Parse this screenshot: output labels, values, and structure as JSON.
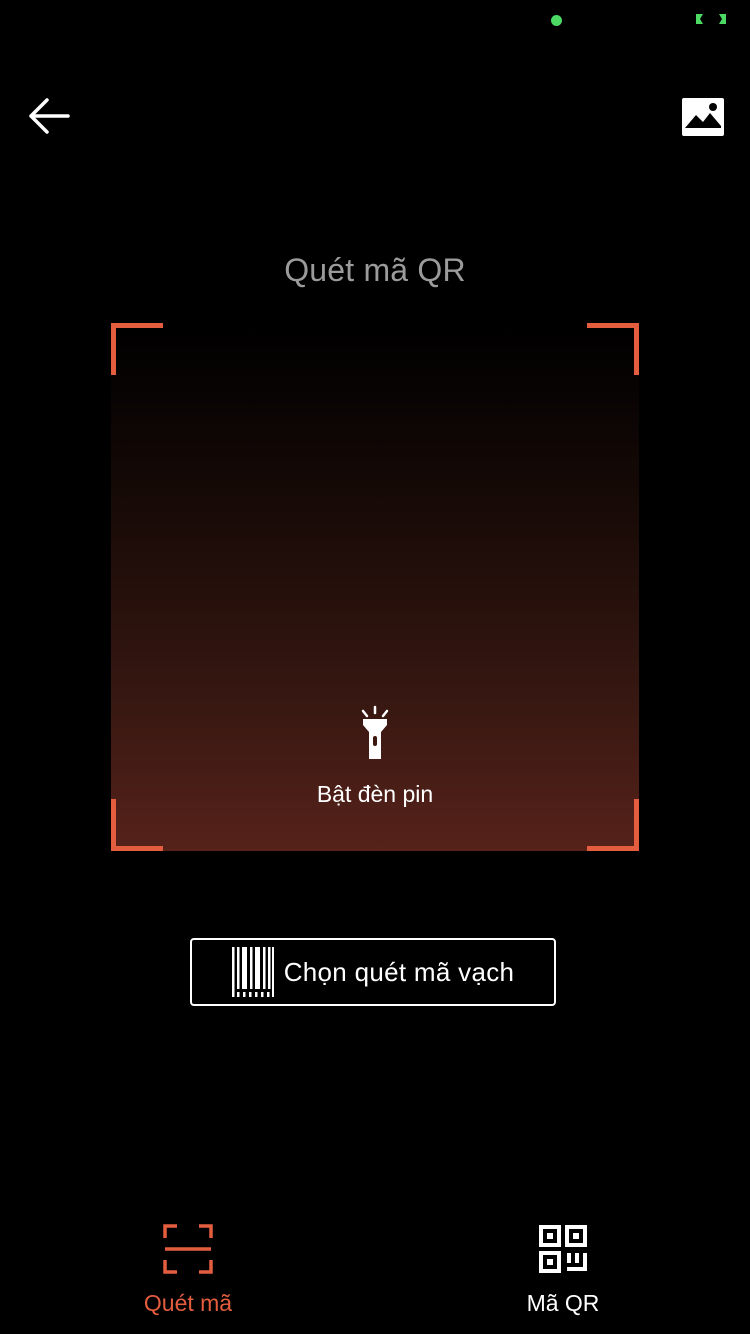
{
  "colors": {
    "background": "#000000",
    "accent": "#e45d3f",
    "status_green": "#4cd964",
    "title_gray": "#9b9b9b",
    "white": "#ffffff"
  },
  "icons": {
    "back": "arrow-left-icon",
    "gallery": "image-gallery-icon",
    "flashlight": "flashlight-icon",
    "barcode": "barcode-icon",
    "scan_tab": "scan-frame-icon",
    "qr_tab": "qr-code-icon"
  },
  "header": {
    "title": "Quét mã QR"
  },
  "scanner": {
    "flash_label": "Bật đèn pin"
  },
  "barcode_button": {
    "label": "Chọn quét mã vạch"
  },
  "bottom_nav": {
    "tabs": [
      {
        "label": "Quét mã",
        "active": true,
        "color": "#e45d3f"
      },
      {
        "label": "Mã QR",
        "active": false,
        "color": "#ffffff"
      }
    ]
  }
}
